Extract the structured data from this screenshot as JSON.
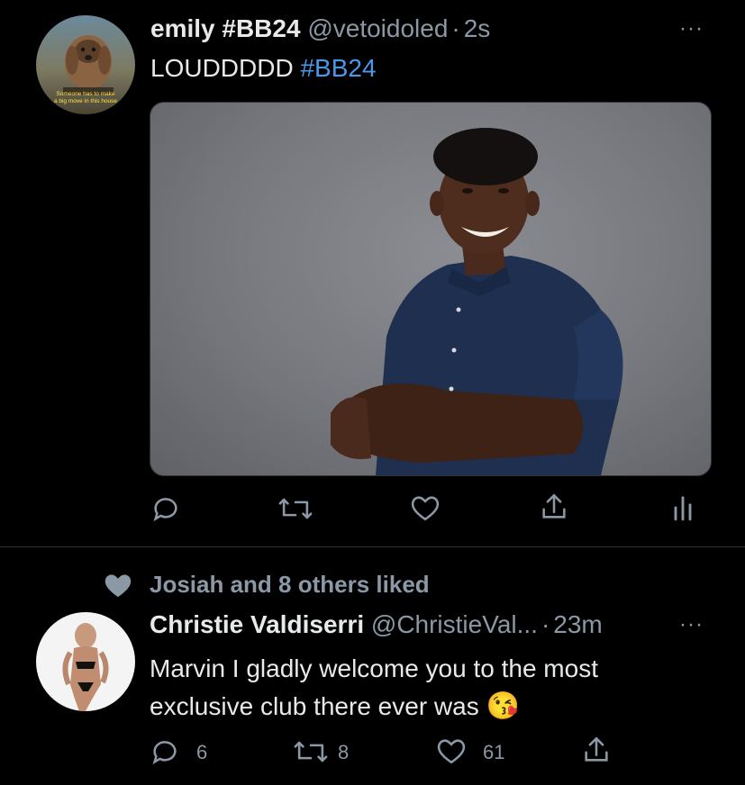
{
  "tweet1": {
    "display_name": "emily #BB24",
    "handle": "@vetoidoled",
    "separator": "·",
    "time": "2s",
    "text_plain": "LOUDDDDD ",
    "text_hashtag": "#BB24",
    "avatar_caption_line1": "Someone has to make",
    "avatar_caption_line2": "a big move in this house",
    "more_glyph": "···",
    "actions": [
      "reply-icon",
      "retweet-icon",
      "like-icon",
      "share-icon",
      "analytics-icon"
    ]
  },
  "tweet2": {
    "social_context": "Josiah and 8 others liked",
    "display_name": "Christie Valdiserri",
    "handle": "@ChristieVal...",
    "separator": "·",
    "time": "23m",
    "text_line1": "Marvin I gladly welcome you to the most",
    "text_line2": "exclusive club there ever was",
    "emoji": "😘",
    "more_glyph": "···",
    "reply_count": "6",
    "retweet_count": "8",
    "like_count": "61"
  },
  "colors": {
    "background": "#000000",
    "text": "#e7e9ea",
    "secondary": "#8b98a5",
    "link": "#4a98e8",
    "divider": "#2f3336"
  }
}
